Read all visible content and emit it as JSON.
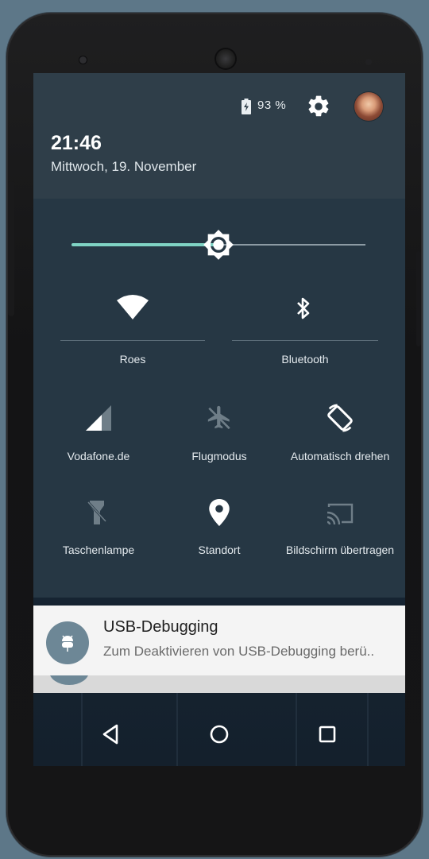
{
  "status": {
    "battery_percent": "93 %",
    "battery_icon": "battery-charging-icon",
    "settings_icon": "gear-icon",
    "avatar": "user-avatar"
  },
  "clock": {
    "time": "21:46",
    "date": "Mittwoch, 19. November"
  },
  "brightness": {
    "level": 0.5,
    "icon": "brightness-icon"
  },
  "tiles": [
    {
      "label": "Roes",
      "icon": "wifi-icon",
      "active": true
    },
    {
      "label": "Bluetooth",
      "icon": "bluetooth-icon",
      "active": true
    },
    {
      "label": "Vodafone.de",
      "icon": "cell-signal-icon",
      "active": true
    },
    {
      "label": "Flugmodus",
      "icon": "airplane-icon",
      "active": false
    },
    {
      "label": "Automatisch drehen",
      "icon": "auto-rotate-icon",
      "active": true
    },
    {
      "label": "Taschenlampe",
      "icon": "flashlight-icon",
      "active": false
    },
    {
      "label": "Standort",
      "icon": "location-icon",
      "active": true
    },
    {
      "label": "Bildschirm übertragen",
      "icon": "cast-icon",
      "active": false
    }
  ],
  "notification": {
    "title": "USB-Debugging",
    "text": "Zum Deaktivieren von USB-Debugging berü..",
    "icon": "android-debug-icon"
  },
  "navbar": {
    "back_icon": "back-icon",
    "home_icon": "home-icon",
    "recents_icon": "recents-icon"
  },
  "colors": {
    "accent": "#7fd3c4",
    "header_bg": "#2f3e49",
    "panel_bg": "#263744",
    "notification_bg": "#f4f4f4"
  }
}
